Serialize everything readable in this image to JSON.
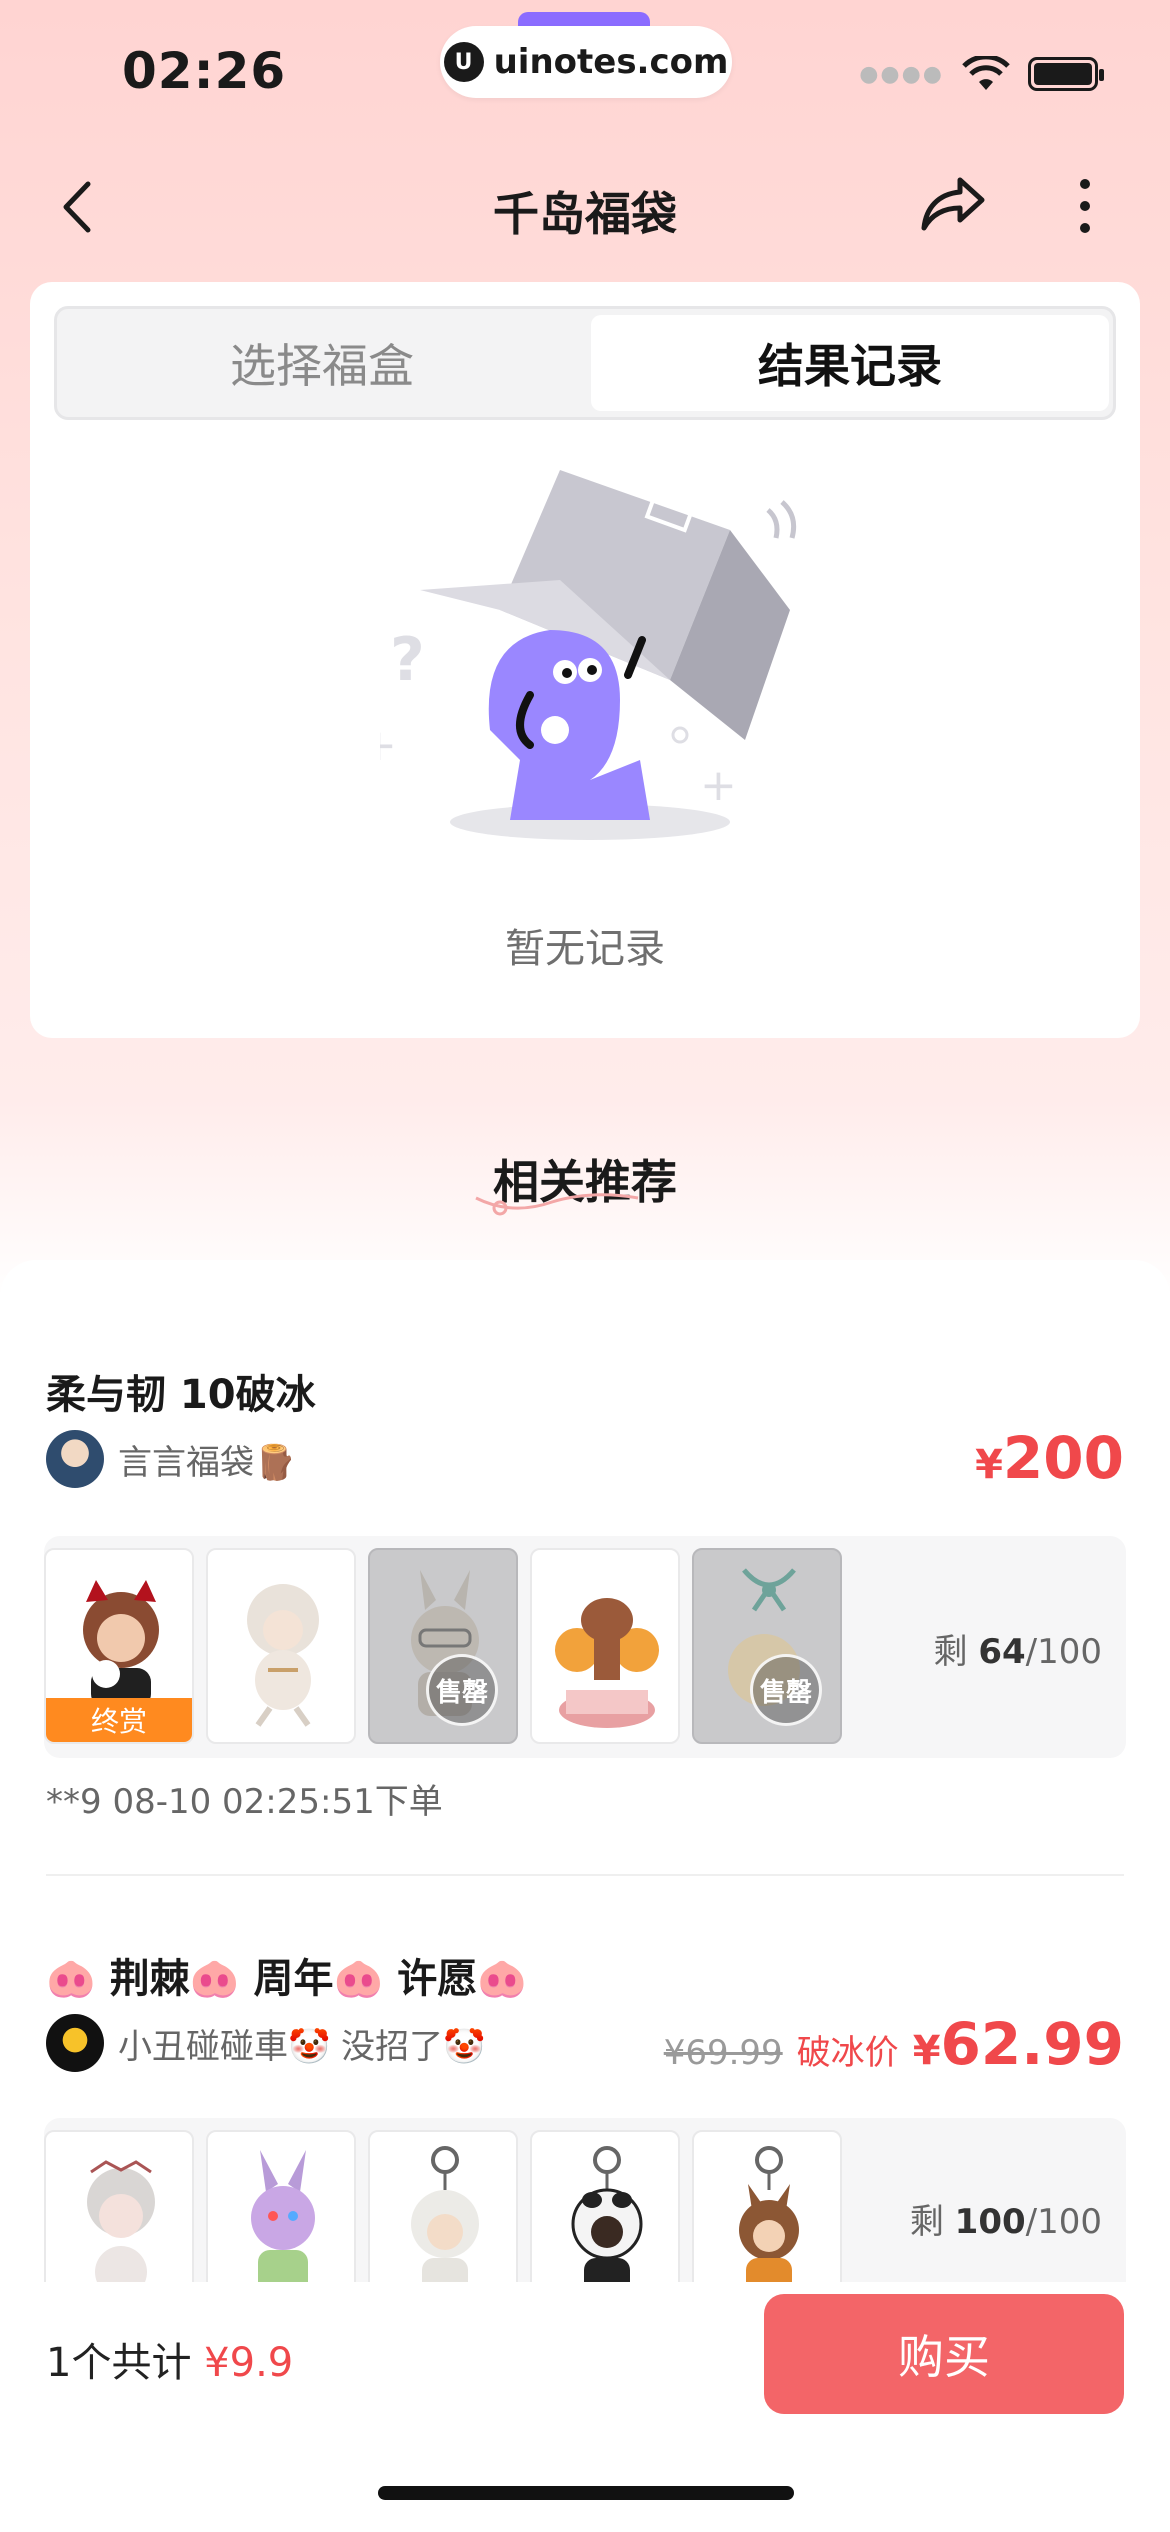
{
  "status": {
    "time": "02:26",
    "url": "uinotes.com"
  },
  "header": {
    "title": "千岛福袋"
  },
  "tabs": [
    {
      "label": "选择福盒",
      "active": false
    },
    {
      "label": "结果记录",
      "active": true
    }
  ],
  "empty": {
    "text": "暂无记录"
  },
  "recommend": {
    "title": "相关推荐",
    "items": [
      {
        "title": "柔与韧 10破冰",
        "shop": "言言福袋🪵",
        "price_symbol": "¥",
        "price": "200",
        "remaining": "64",
        "total": "/100",
        "remain_label": "剩",
        "final_tag": "终赏",
        "sold_label": "售罄",
        "order_note": "**9 08-10 02:25:51下单"
      },
      {
        "title": "🐽 荆棘🐽 周年🐽 许愿🐽",
        "shop": "小丑碰碰車🤡 没招了🤡",
        "original_price": "¥69.99",
        "ice_label": "破冰价",
        "price_symbol": "¥",
        "price": "62.99",
        "remaining": "100",
        "total": "/100",
        "remain_label": "剩"
      }
    ]
  },
  "footer": {
    "count_label": "1个共计",
    "total_price": "¥9.9",
    "buy_label": "购买"
  },
  "colors": {
    "accent": "#f0484b",
    "buy_button": "#f36568",
    "final_tag": "#ff8a1f"
  }
}
